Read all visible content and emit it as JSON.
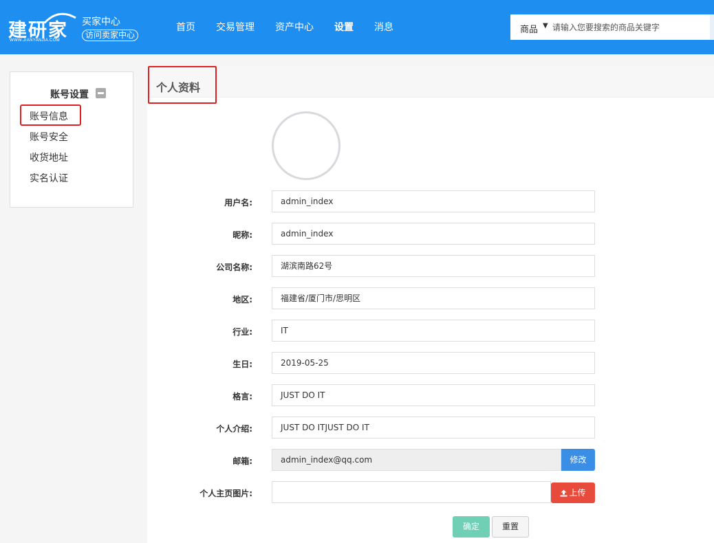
{
  "header": {
    "logo_text": "建研家",
    "logo_sub": "WWW.JIANYANJIA.COM",
    "center_title": "买家中心",
    "visit_seller": "访问卖家中心",
    "nav": [
      "首页",
      "交易管理",
      "资产中心",
      "设置",
      "消息"
    ],
    "active_nav": "设置",
    "search": {
      "category": "商品",
      "placeholder": "请输入您要搜索的商品关键字"
    }
  },
  "sidebar": {
    "title": "账号设置",
    "items": [
      "账号信息",
      "账号安全",
      "收货地址",
      "实名认证"
    ]
  },
  "main": {
    "title": "个人资料",
    "fields": [
      {
        "label": "用户名:",
        "value": "admin_index"
      },
      {
        "label": "昵称:",
        "value": "admin_index"
      },
      {
        "label": "公司名称:",
        "value": "湖滨南路62号"
      },
      {
        "label": "地区:",
        "value": "福建省/厦门市/思明区"
      },
      {
        "label": "行业:",
        "value": "IT"
      },
      {
        "label": "生日:",
        "value": "2019-05-25"
      },
      {
        "label": "格言:",
        "value": "JUST DO IT"
      },
      {
        "label": "个人介绍:",
        "value": "JUST DO ITJUST DO IT"
      }
    ],
    "email": {
      "label": "邮箱:",
      "value": "admin_index@qq.com",
      "edit_label": "修改"
    },
    "homepage_image": {
      "label": "个人主页图片:",
      "value": "",
      "upload_label": "上传"
    },
    "confirm_label": "确定",
    "reset_label": "重置"
  },
  "colors": {
    "header_bg": "#1e8ef0",
    "highlight": "#e02020",
    "edit_button": "#3a8ee6",
    "upload_button": "#e84a3b",
    "confirm_button": "#6fd0b5"
  }
}
